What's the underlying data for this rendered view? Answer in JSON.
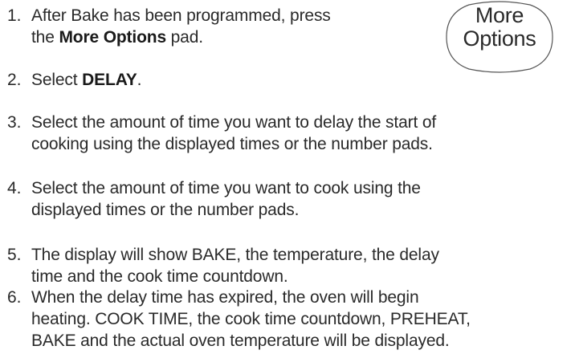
{
  "steps": [
    {
      "number": "1.",
      "line1": "After Bake has been programmed, press",
      "line2_pre": "the ",
      "line2_bold": "More Options",
      "line2_post": " pad."
    },
    {
      "number": "2.",
      "pre": "Select ",
      "bold": "DELAY",
      "post": "."
    },
    {
      "number": "3.",
      "line1": "Select the amount of time you want to delay the start of",
      "line2": "cooking using the displayed times or the number pads."
    },
    {
      "number": "4.",
      "line1": "Select the amount of time you want to cook using the",
      "line2": "displayed times or the number pads."
    },
    {
      "number": "5.",
      "line1": "The display will show BAKE, the temperature, the delay",
      "line2": "time and the cook time countdown."
    },
    {
      "number": "6.",
      "line1": "When the delay time has expired, the oven will begin",
      "line2": "heating. COOK TIME, the cook time countdown, PREHEAT,",
      "line3": "BAKE and the actual oven temperature will be displayed."
    }
  ],
  "pad_badge": {
    "line1": "More",
    "line2": "Options"
  }
}
